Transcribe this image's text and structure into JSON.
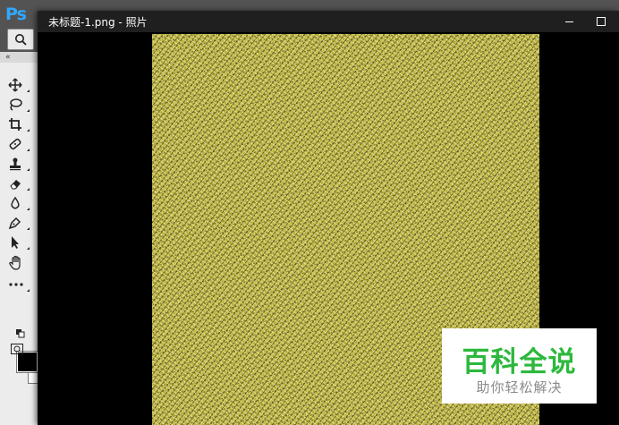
{
  "photoshop": {
    "logo": "Ps",
    "fg_color": "#000000",
    "bg_color": "#ffffff",
    "tools": [
      {
        "icon": "move-icon"
      },
      {
        "icon": "lasso-icon"
      },
      {
        "icon": "crop-icon"
      },
      {
        "icon": "healing-brush-icon"
      },
      {
        "icon": "clone-stamp-icon"
      },
      {
        "icon": "eraser-icon"
      },
      {
        "icon": "blur-icon"
      },
      {
        "icon": "pen-icon"
      },
      {
        "icon": "path-selection-icon"
      },
      {
        "icon": "hand-icon"
      },
      {
        "icon": "more-tools-icon"
      }
    ]
  },
  "photo_window": {
    "title": "未标题-1.png - 照片",
    "background": "#000000",
    "image_color": "#b5ab38"
  },
  "watermark": {
    "title": "百科全说",
    "subtitle": "助你轻松解决",
    "title_color": "#2db83d"
  }
}
